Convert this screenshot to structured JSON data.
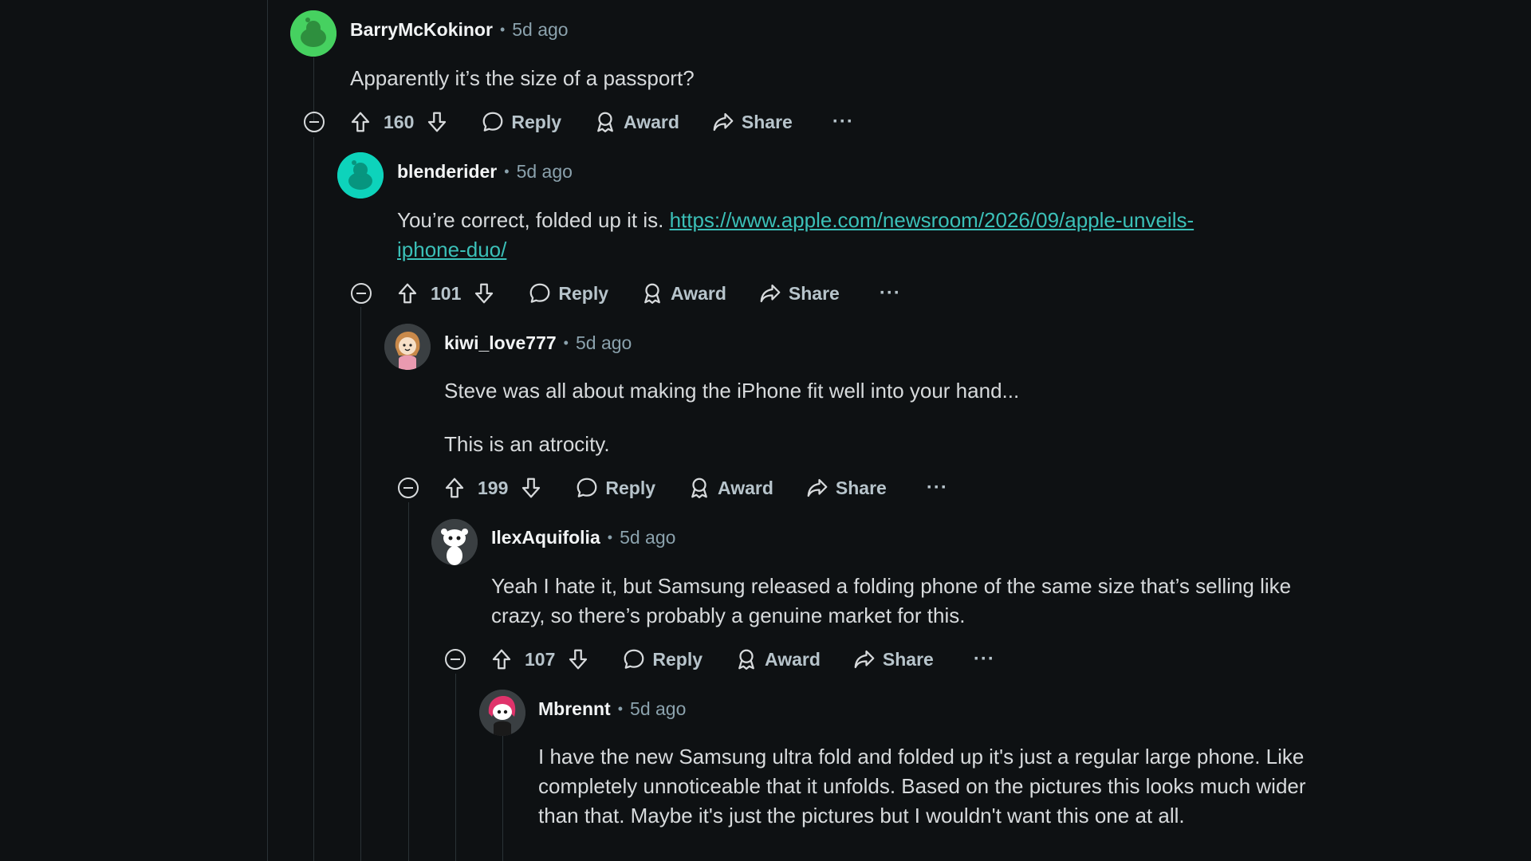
{
  "comments": [
    {
      "username": "BarryMcKokinor",
      "time": "5d ago",
      "paragraphs": [
        "Apparently it’s the size of a passport?"
      ],
      "score": "160",
      "avatar_color": "#46d160"
    },
    {
      "username": "blenderider",
      "time": "5d ago",
      "text_before_link": "You’re correct, folded up it is. ",
      "link_line1": "https://www.apple.com/newsroom/2026/09/apple-unveils-",
      "link_line2": "iphone-duo/",
      "score": "101",
      "avatar_color": "#0dd3bb"
    },
    {
      "username": "kiwi_love777",
      "time": "5d ago",
      "paragraphs": [
        "Steve was all about making the iPhone fit well into your hand...",
        "This is an atrocity."
      ],
      "score": "199",
      "avatar_color": "#3a3f42"
    },
    {
      "username": "IlexAquifolia",
      "time": "5d ago",
      "paragraphs": [
        "Yeah I hate it, but Samsung released a folding phone of the same size that’s selling like crazy, so there’s probably a genuine market for this."
      ],
      "score": "107",
      "avatar_color": "#3a3f42"
    },
    {
      "username": "Mbrennt",
      "time": "5d ago",
      "paragraphs": [
        "I have the new Samsung ultra fold and folded up it's just a regular large phone. Like completely unnoticeable that it unfolds. Based on the pictures this looks much wider than that. Maybe it's just the pictures but I wouldn't want this one at all."
      ],
      "avatar_color": "#3a3f42"
    }
  ],
  "actions": {
    "reply": "Reply",
    "award": "Award",
    "share": "Share",
    "more": "···"
  },
  "separator": "•",
  "colors": {
    "background": "#0e1113",
    "link": "#3bc0b8",
    "meta": "#8ba2ad",
    "thread_line": "#2a3236"
  },
  "icons": {
    "upvote": "arrow-up-icon",
    "downvote": "arrow-down-icon",
    "reply": "speech-bubble-icon",
    "award": "award-ribbon-icon",
    "share": "share-arrow-icon",
    "collapse": "minus-circle-icon"
  }
}
